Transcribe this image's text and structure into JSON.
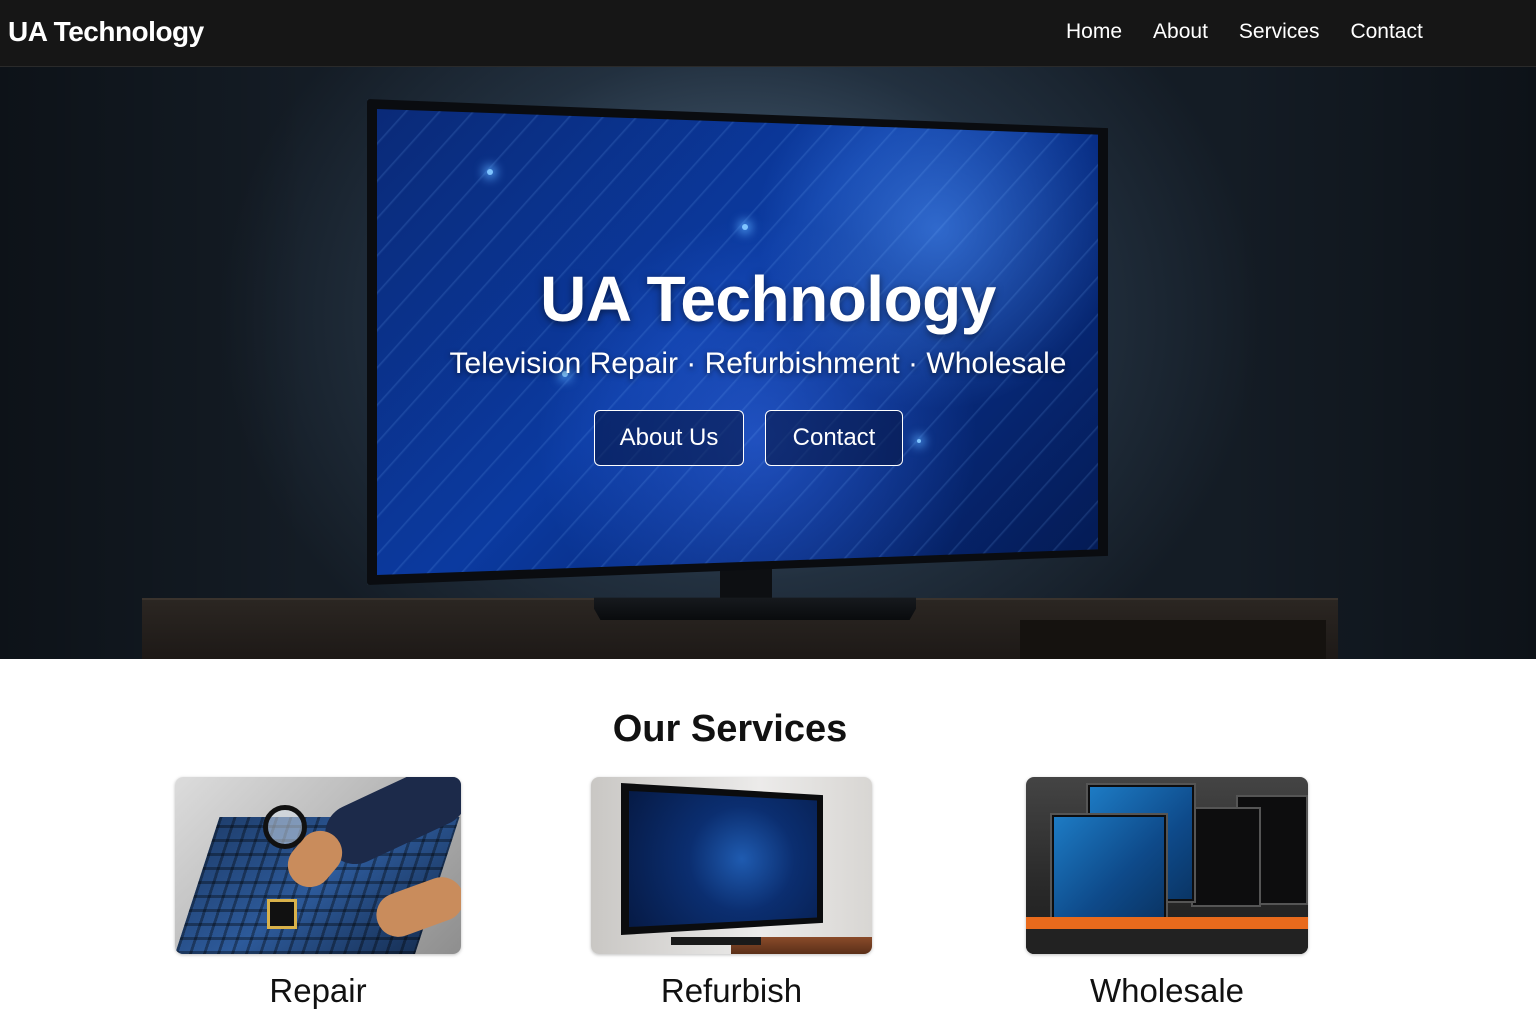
{
  "nav": {
    "brand": "UA Technology",
    "links": [
      "Home",
      "About",
      "Services",
      "Contact"
    ]
  },
  "hero": {
    "title": "UA Technology",
    "tagline": "Television Repair · Refurbishment · Wholesale",
    "buttons": [
      "About Us",
      "Contact"
    ]
  },
  "services": {
    "title": "Our Services",
    "cards": [
      {
        "label": "Repair"
      },
      {
        "label": "Refurbish"
      },
      {
        "label": "Wholesale"
      }
    ]
  },
  "colors": {
    "navbar_bg": "#161616",
    "screen_blue": "#0b3aa0",
    "accent_orange": "#e86a1c"
  }
}
